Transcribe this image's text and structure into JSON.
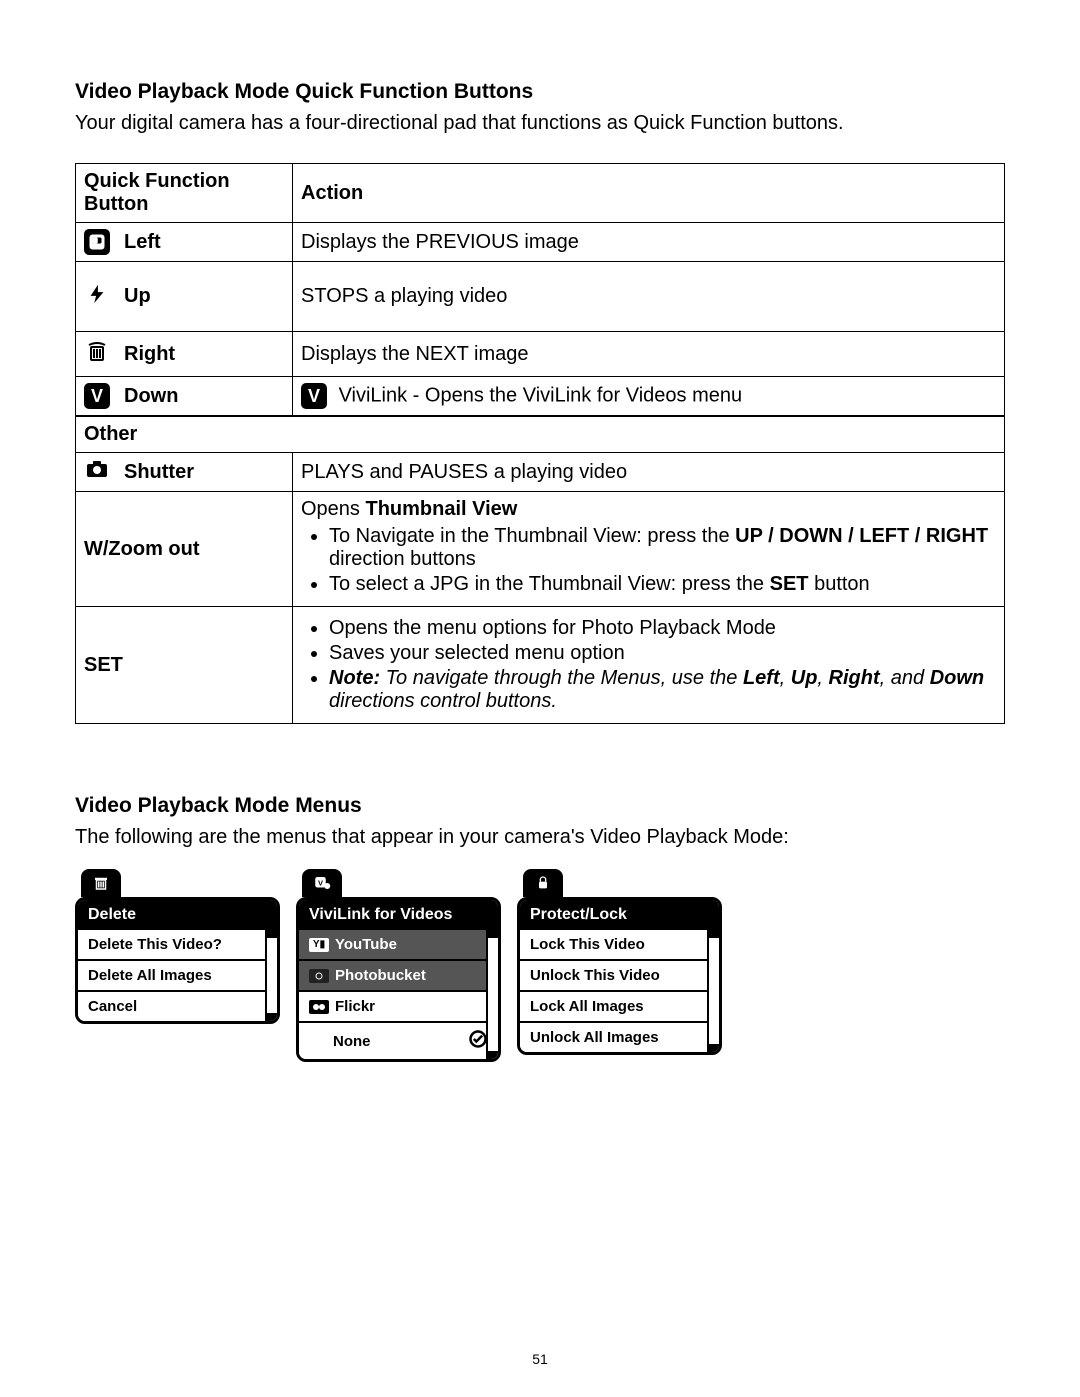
{
  "page_number": "51",
  "section1": {
    "title": "Video Playback Mode Quick Function Buttons",
    "intro": "Your digital camera has a four-directional pad that functions as Quick Function buttons.",
    "table_headers": {
      "button": "Quick Function Button",
      "action": "Action"
    },
    "rows": {
      "left": {
        "label": "Left",
        "icon": "slideshow-icon",
        "action_plain": "Displays the PREVIOUS image"
      },
      "up": {
        "label": "Up",
        "icon": "flash-icon",
        "action_plain": "STOPS a playing video"
      },
      "right": {
        "label": "Right",
        "icon": "trash-icon",
        "action_plain": "Displays the NEXT image"
      },
      "down": {
        "label": "Down",
        "icon": "v-icon",
        "action_prefix_icon": "v-icon",
        "action_plain": "ViviLink - Opens the ViviLink for Videos menu"
      }
    },
    "other_label": "Other",
    "other_rows": {
      "shutter": {
        "label": "Shutter",
        "icon": "camera-icon",
        "action_plain": "PLAYS and PAUSES a playing video"
      },
      "zoom": {
        "label": "W/Zoom out",
        "action_heading_pre": "Opens ",
        "action_heading_bold": "Thumbnail View",
        "bullets": {
          "b1_pre": "To Navigate in the Thumbnail View: press the ",
          "b1_bold": "UP / DOWN / LEFT / RIGHT",
          "b1_post": " direction buttons",
          "b2_pre": "To select a JPG in the Thumbnail View: press the ",
          "b2_bold": "SET",
          "b2_post": " button"
        }
      },
      "set": {
        "label": "SET",
        "bullets": {
          "b1": "Opens the menu options for Photo Playback Mode",
          "b2": "Saves your selected menu option",
          "b3_note_bold": "Note:",
          "b3_pre": " To navigate through the Menus, use the ",
          "b3_bold1": "Left",
          "b3_comma1": ", ",
          "b3_bold2": "Up",
          "b3_comma2": ", ",
          "b3_bold3": "Right",
          "b3_and": ", and ",
          "b3_bold4": "Down",
          "b3_post": " directions control buttons."
        }
      }
    }
  },
  "section2": {
    "title": "Video Playback Mode Menus",
    "intro": "The following are the menus that appear in your camera's Video Playback Mode:",
    "menus": {
      "delete": {
        "tab_icon": "trash-icon",
        "title": "Delete",
        "items": [
          "Delete This Video?",
          "Delete All Images",
          "Cancel"
        ]
      },
      "vivilink": {
        "tab_icon": "vivilink-icon",
        "title": "ViviLink for Videos",
        "items": [
          {
            "label": "YouTube",
            "icon": "youtube-icon",
            "gray": true
          },
          {
            "label": "Photobucket",
            "icon": "photobucket-icon",
            "gray": true
          },
          {
            "label": "Flickr",
            "icon": "flickr-icon",
            "gray": false
          },
          {
            "label": "None",
            "check": true,
            "gray": false
          }
        ]
      },
      "protect": {
        "tab_icon": "lock-icon",
        "title": "Protect/Lock",
        "items": [
          "Lock This Video",
          "Unlock This Video",
          "Lock All Images",
          "Unlock All Images"
        ]
      }
    }
  }
}
